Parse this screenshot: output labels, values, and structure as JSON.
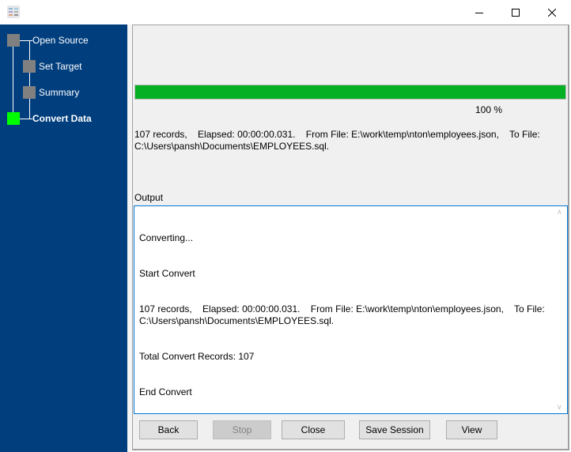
{
  "window": {
    "icon": "app-icon",
    "controls": {
      "minimize": "minimize-icon",
      "maximize": "maximize-icon",
      "close": "close-icon"
    }
  },
  "sidebar": {
    "steps": [
      {
        "label": "Open Source",
        "state": "done"
      },
      {
        "label": "Set Target",
        "state": "done"
      },
      {
        "label": "Summary",
        "state": "done"
      },
      {
        "label": "Convert Data",
        "state": "active"
      }
    ],
    "colors": {
      "background": "#003e7e",
      "done": "#808080",
      "active": "#00ff00"
    }
  },
  "progress": {
    "value_percent": 100,
    "label": "100 %",
    "color": "#06b025"
  },
  "summary": {
    "text": "107 records,    Elapsed: 00:00:00.031.    From File: E:\\work\\temp\\nton\\employees.json,    To File: C:\\Users\\pansh\\Documents\\EMPLOYEES.sql."
  },
  "output": {
    "label": "Output",
    "lines": [
      "Converting...",
      "Start Convert",
      "107 records,    Elapsed: 00:00:00.031.    From File: E:\\work\\temp\\nton\\employees.json,    To File: C:\\Users\\pansh\\Documents\\EMPLOYEES.sql.",
      "Total Convert Records: 107",
      "End Convert"
    ]
  },
  "buttons": {
    "back": "Back",
    "stop": "Stop",
    "close": "Close",
    "save_session": "Save Session",
    "view": "View"
  }
}
